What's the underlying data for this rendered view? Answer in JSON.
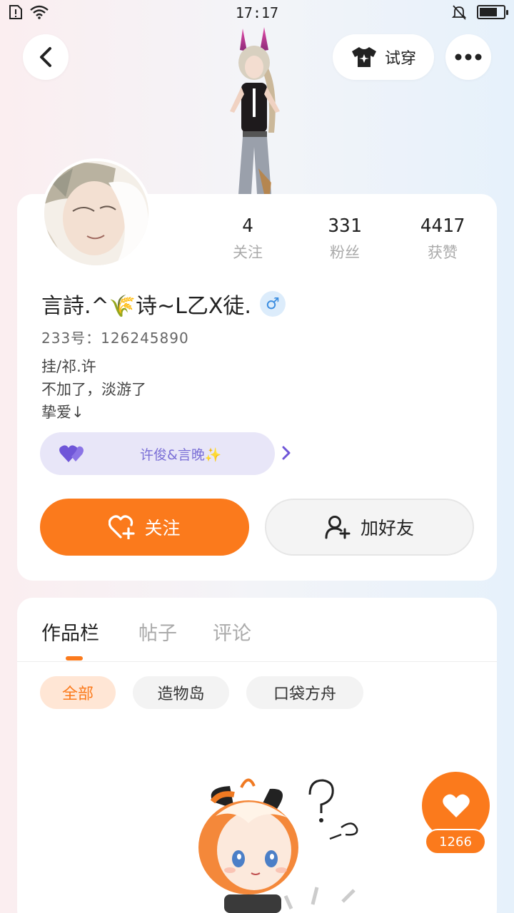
{
  "status_bar": {
    "time": "17:17",
    "icons_left": [
      "sim-alert-icon",
      "wifi-icon"
    ],
    "icons_right": [
      "mute-bell-icon",
      "battery-icon"
    ],
    "battery_level": 0.75
  },
  "header": {
    "back_icon": "chevron-left-icon",
    "tryon_icon": "tshirt-icon",
    "tryon_label": "试穿",
    "more_icon": "more-dots-icon"
  },
  "profile": {
    "stats": [
      {
        "value": "4",
        "label": "关注"
      },
      {
        "value": "331",
        "label": "粉丝"
      },
      {
        "value": "4417",
        "label": "获赞"
      }
    ],
    "username": "言詩.^🌾诗~ᒪ乙X徒.",
    "gender_symbol": "♂",
    "user_id": "233号：126245890",
    "bio_lines": [
      "挂/祁.许",
      "不加了，淡游了",
      "挚爱↓"
    ],
    "cp_text": "许俊&言晚✨",
    "follow_label": "关注",
    "add_friend_label": "加好友"
  },
  "content": {
    "tabs": [
      {
        "label": "作品栏",
        "active": true
      },
      {
        "label": "帖子",
        "active": false
      },
      {
        "label": "评论",
        "active": false
      }
    ],
    "chips": [
      {
        "label": "全部",
        "active": true
      },
      {
        "label": "造物岛",
        "active": false
      },
      {
        "label": "口袋方舟",
        "active": false
      }
    ]
  },
  "like": {
    "count": "1266"
  },
  "colors": {
    "accent": "#fb7a1c",
    "cp_purple": "#7a6fd6",
    "gender_blue": "#3b8de0"
  }
}
